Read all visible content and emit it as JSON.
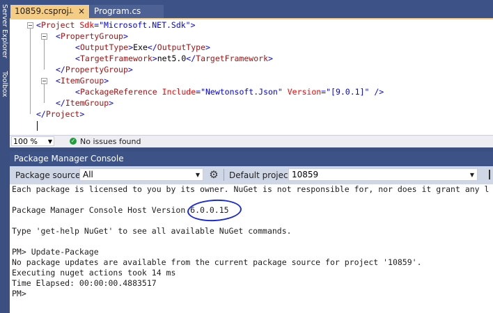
{
  "sidebar": {
    "sse_label": "Server Explorer",
    "toolbox_label": "Toolbox"
  },
  "tabs": [
    {
      "label": "10859.csproj",
      "active": true,
      "pin_icon": "pin-icon",
      "close_icon": "close-icon"
    },
    {
      "label": "Program.cs",
      "active": false
    }
  ],
  "editor": {
    "lines": [
      {
        "indent": 0,
        "parts": [
          [
            "br",
            "<"
          ],
          [
            "el",
            "Project"
          ],
          [
            "txt",
            " "
          ],
          [
            "at",
            "Sdk"
          ],
          [
            "eq",
            "="
          ],
          [
            "val",
            "\"Microsoft.NET.Sdk\""
          ],
          [
            "br",
            ">"
          ]
        ]
      },
      {
        "indent": 1,
        "parts": [
          [
            "br",
            "<"
          ],
          [
            "el",
            "PropertyGroup"
          ],
          [
            "br",
            ">"
          ]
        ]
      },
      {
        "indent": 2,
        "parts": [
          [
            "br",
            "<"
          ],
          [
            "el",
            "OutputType"
          ],
          [
            "br",
            ">"
          ],
          [
            "txt",
            "Exe"
          ],
          [
            "br",
            "</"
          ],
          [
            "el",
            "OutputType"
          ],
          [
            "br",
            ">"
          ]
        ]
      },
      {
        "indent": 2,
        "parts": [
          [
            "br",
            "<"
          ],
          [
            "el",
            "TargetFramework"
          ],
          [
            "br",
            ">"
          ],
          [
            "txt",
            "net5.0"
          ],
          [
            "br",
            "</"
          ],
          [
            "el",
            "TargetFramework"
          ],
          [
            "br",
            ">"
          ]
        ]
      },
      {
        "indent": 1,
        "parts": [
          [
            "br",
            "</"
          ],
          [
            "el",
            "PropertyGroup"
          ],
          [
            "br",
            ">"
          ]
        ]
      },
      {
        "indent": 1,
        "parts": [
          [
            "br",
            "<"
          ],
          [
            "el",
            "ItemGroup"
          ],
          [
            "br",
            ">"
          ]
        ]
      },
      {
        "indent": 2,
        "parts": [
          [
            "br",
            "<"
          ],
          [
            "el",
            "PackageReference"
          ],
          [
            "txt",
            " "
          ],
          [
            "at",
            "Include"
          ],
          [
            "eq",
            "="
          ],
          [
            "val",
            "\"Newtonsoft.Json\""
          ],
          [
            "txt",
            " "
          ],
          [
            "at",
            "Version"
          ],
          [
            "eq",
            "="
          ],
          [
            "val",
            "\"[9.0.1]\""
          ],
          [
            "br",
            " />"
          ]
        ]
      },
      {
        "indent": 1,
        "parts": [
          [
            "br",
            "</"
          ],
          [
            "el",
            "ItemGroup"
          ],
          [
            "br",
            ">"
          ]
        ]
      },
      {
        "indent": 0,
        "parts": [
          [
            "br",
            "</"
          ],
          [
            "el",
            "Project"
          ],
          [
            "br",
            ">"
          ]
        ]
      }
    ]
  },
  "editor_status": {
    "zoom": "100 %",
    "issues": "No issues found"
  },
  "pmc": {
    "title": "Package Manager Console",
    "source_label": "Package source:",
    "source_value": "All",
    "project_label": "Default project:",
    "project_value": "10859",
    "lines": [
      "Each package is licensed to you by its owner. NuGet is not responsible for, nor does it grant any l",
      "",
      "Package Manager Console Host Version 6.0.0.15",
      "",
      "Type 'get-help NuGet' to see all available NuGet commands.",
      "",
      "PM> Update-Package",
      "No package updates are available from the current package source for project '10859'.",
      "Executing nuget actions took 14 ms",
      "Time Elapsed: 00:00:00.4883517",
      "PM>"
    ]
  },
  "colors": {
    "tab_active": "#f5cc84",
    "chrome": "#3d5286",
    "annotation_circle": "#1a2bd6"
  }
}
